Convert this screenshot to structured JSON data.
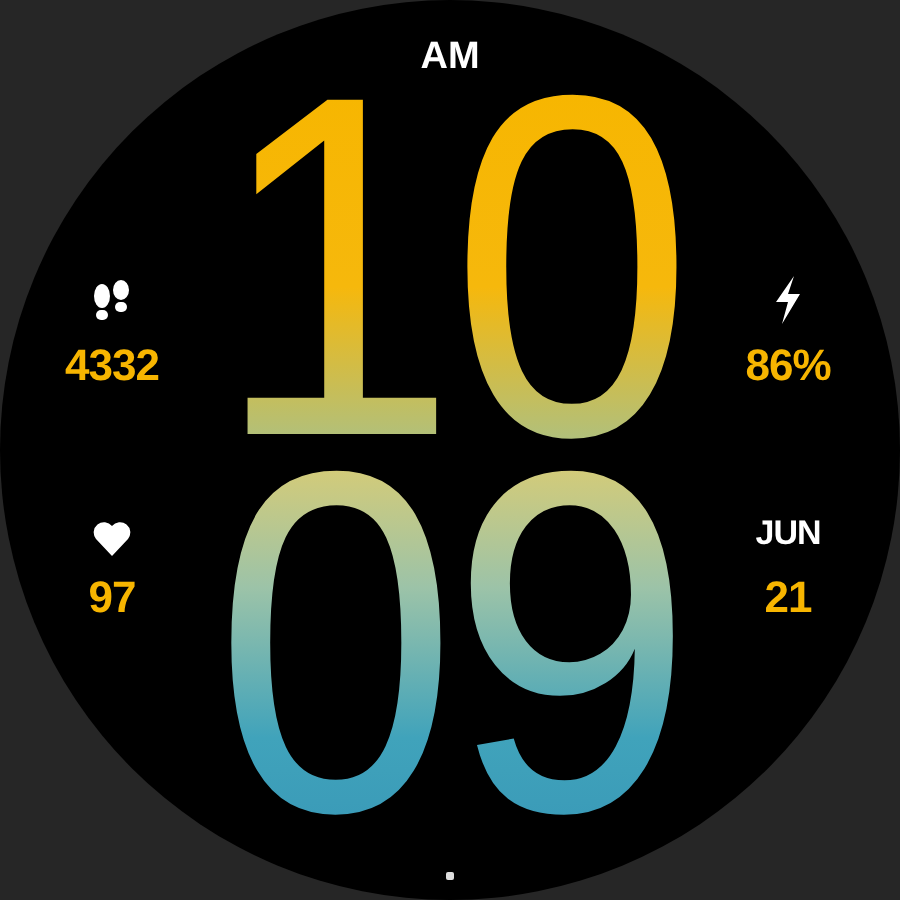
{
  "period": "AM",
  "hours": "10",
  "minutes": "09",
  "left": [
    {
      "kind": "steps",
      "value": "4332"
    },
    {
      "kind": "heart",
      "value": "97"
    }
  ],
  "right": [
    {
      "kind": "battery",
      "value": "86%"
    },
    {
      "kind": "date",
      "label": "JUN",
      "value": "21"
    }
  ]
}
